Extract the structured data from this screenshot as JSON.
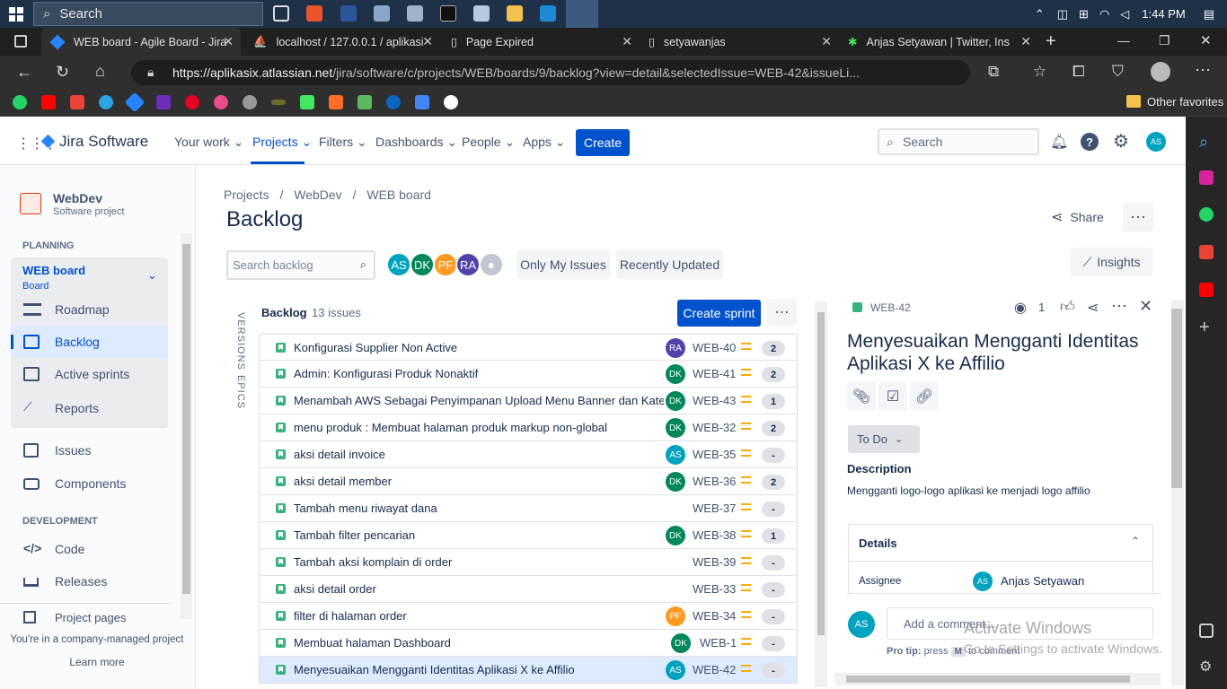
{
  "taskbar": {
    "search_placeholder": "Search",
    "time": "1:44 PM"
  },
  "browser": {
    "tabs": [
      {
        "title": "WEB board - Agile Board - Jira"
      },
      {
        "title": "localhost / 127.0.0.1 / aplikasi"
      },
      {
        "title": "Page Expired"
      },
      {
        "title": "setyawanjas"
      },
      {
        "title": "Anjas Setyawan | Twitter, Insta"
      }
    ],
    "url_domain": "https://aplikasix.atlassian.net",
    "url_path": "/jira/software/c/projects/WEB/boards/9/backlog?view=detail&selectedIssue=WEB-42&issueLi...",
    "other_favorites": "Other favorites"
  },
  "jira": {
    "product": "Jira Software",
    "nav": [
      "Your work",
      "Projects",
      "Filters",
      "Dashboards",
      "People",
      "Apps"
    ],
    "create": "Create",
    "search_placeholder": "Search",
    "user_initials": "AS"
  },
  "sidebar": {
    "project_name": "WebDev",
    "project_type": "Software project",
    "planning_heading": "PLANNING",
    "board_name": "WEB board",
    "board_sub": "Board",
    "items": [
      "Roadmap",
      "Backlog",
      "Active sprints",
      "Reports",
      "Issues",
      "Components"
    ],
    "dev_heading": "DEVELOPMENT",
    "dev_items": [
      "Code",
      "Releases",
      "Project pages"
    ],
    "footer": "You're in a company-managed project",
    "learn_more": "Learn more"
  },
  "main": {
    "breadcrumb": [
      "Projects",
      "WebDev",
      "WEB board"
    ],
    "title": "Backlog",
    "share": "Share",
    "search_placeholder": "Search backlog",
    "avatars": [
      "AS",
      "DK",
      "PF",
      "RA"
    ],
    "only_my_issues": "Only My Issues",
    "recently_updated": "Recently Updated",
    "insights": "Insights",
    "versions_label": "VERSIONS",
    "epics_label": "EPICS",
    "backlog_label": "Backlog",
    "issue_count": "13 issues",
    "create_sprint": "Create sprint"
  },
  "issues": [
    {
      "summary": "Konfigurasi Supplier Non Active",
      "assignee": "RA",
      "color": "#5243aa",
      "key": "WEB-40",
      "points": "2"
    },
    {
      "summary": "Admin: Konfigurasi Produk Nonaktif",
      "assignee": "DK",
      "color": "#00875a",
      "key": "WEB-41",
      "points": "2"
    },
    {
      "summary": "Menambah AWS Sebagai Penyimpanan Upload Menu Banner dan Kategori",
      "assignee": "DK",
      "color": "#00875a",
      "key": "WEB-43",
      "points": "1"
    },
    {
      "summary": "menu produk : Membuat halaman produk markup non-global",
      "assignee": "DK",
      "color": "#00875a",
      "key": "WEB-32",
      "points": "2"
    },
    {
      "summary": "aksi detail invoice",
      "assignee": "AS",
      "color": "#00a3bf",
      "key": "WEB-35",
      "points": "-"
    },
    {
      "summary": "aksi detail member",
      "assignee": "DK",
      "color": "#00875a",
      "key": "WEB-36",
      "points": "2"
    },
    {
      "summary": "Tambah menu riwayat dana",
      "assignee": "",
      "color": "",
      "key": "WEB-37",
      "points": "-"
    },
    {
      "summary": "Tambah filter pencarian",
      "assignee": "DK",
      "color": "#00875a",
      "key": "WEB-38",
      "points": "1"
    },
    {
      "summary": "Tambah aksi komplain di order",
      "assignee": "",
      "color": "",
      "key": "WEB-39",
      "points": "-"
    },
    {
      "summary": "aksi detail order",
      "assignee": "",
      "color": "",
      "key": "WEB-33",
      "points": "-"
    },
    {
      "summary": "filter di halaman order",
      "assignee": "PF",
      "color": "#ff991f",
      "key": "WEB-34",
      "points": "-"
    },
    {
      "summary": "Membuat halaman Dashboard",
      "assignee": "DK",
      "color": "#00875a",
      "key": "WEB-1",
      "points": "-"
    },
    {
      "summary": "Menyesuaikan Mengganti Identitas Aplikasi X ke Affilio",
      "assignee": "AS",
      "color": "#00a3bf",
      "key": "WEB-42",
      "points": "-"
    }
  ],
  "detail": {
    "key": "WEB-42",
    "watchers": "1",
    "title": "Menyesuaikan Mengganti Identitas Aplikasi X ke Affilio",
    "status": "To Do",
    "description_label": "Description",
    "description": "Mengganti logo-logo aplikasi ke menjadi logo affilio",
    "details_label": "Details",
    "assignee_label": "Assignee",
    "assignee": "Anjas Setyawan",
    "assignee_initials": "AS",
    "comment_placeholder": "Add a comment...",
    "pro_tip": "Pro tip:",
    "press": "press",
    "key_m": "M",
    "to_comment": "to comment"
  },
  "watermark": {
    "line1": "Activate Windows",
    "line2": "Go to Settings to activate Windows."
  }
}
